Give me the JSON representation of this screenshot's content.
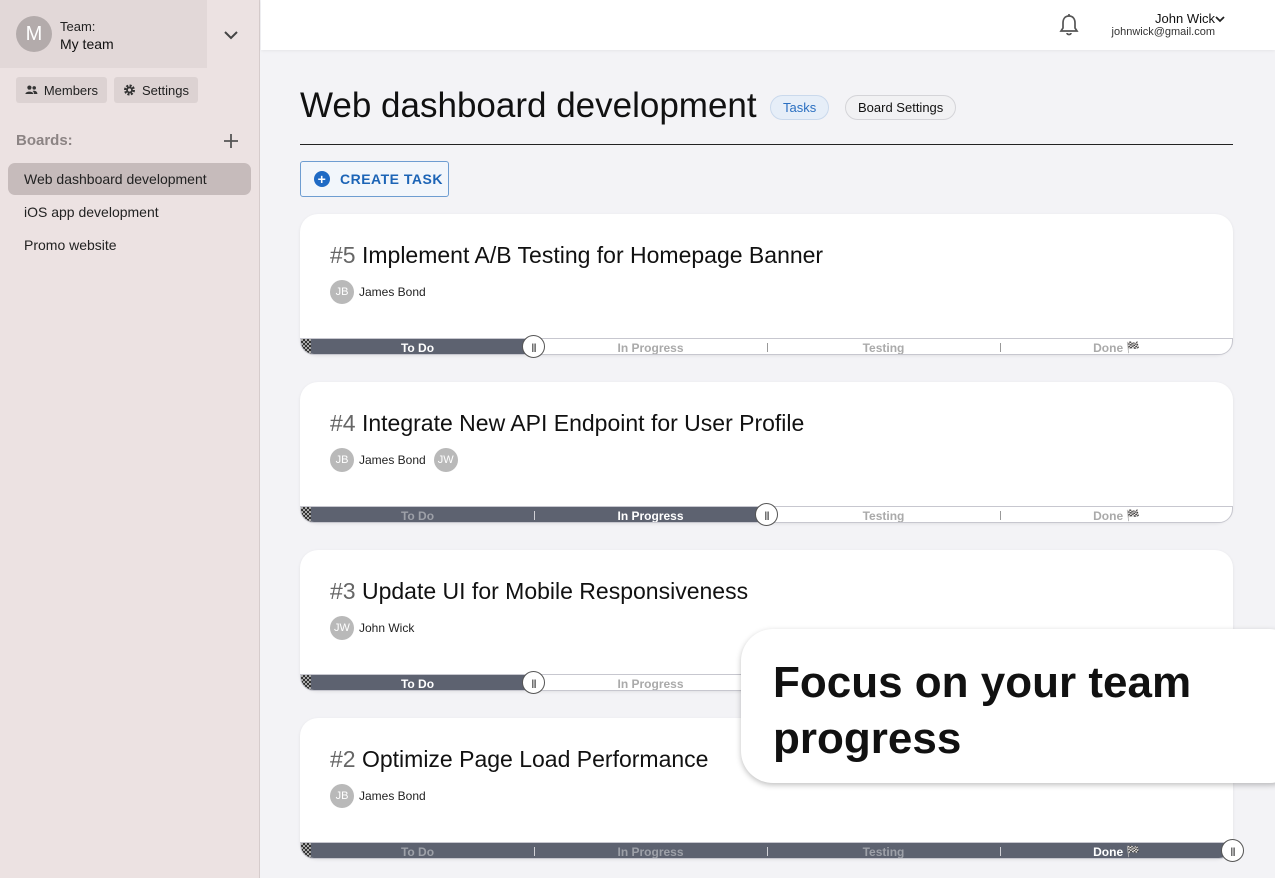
{
  "team": {
    "avatar_letter": "M",
    "label": "Team:",
    "name": "My team"
  },
  "sidebar": {
    "members_label": "Members",
    "settings_label": "Settings",
    "boards_label": "Boards:",
    "boards": [
      {
        "label": "Web dashboard development",
        "active": true
      },
      {
        "label": "iOS app development",
        "active": false
      },
      {
        "label": "Promo website",
        "active": false
      }
    ]
  },
  "user": {
    "name": "John Wick",
    "email": "johnwick@gmail.com"
  },
  "header": {
    "title": "Web dashboard development",
    "tabs": [
      {
        "label": "Tasks",
        "active": true
      },
      {
        "label": "Board Settings",
        "active": false
      }
    ],
    "create_label": "CREATE TASK"
  },
  "stages": [
    "To Do",
    "In Progress",
    "Testing",
    "Done"
  ],
  "tasks": [
    {
      "number": "#5",
      "title": "Implement A/B Testing for Homepage Banner",
      "assignees": [
        {
          "initials": "JB",
          "name": "James Bond"
        }
      ],
      "stage_index": 0
    },
    {
      "number": "#4",
      "title": "Integrate New API Endpoint for User Profile",
      "assignees": [
        {
          "initials": "JB",
          "name": "James Bond"
        },
        {
          "initials": "JW",
          "name": ""
        }
      ],
      "stage_index": 1
    },
    {
      "number": "#3",
      "title": "Update UI for Mobile Responsiveness",
      "assignees": [
        {
          "initials": "JW",
          "name": "John Wick"
        }
      ],
      "stage_index": 0
    },
    {
      "number": "#2",
      "title": "Optimize Page Load Performance",
      "assignees": [
        {
          "initials": "JB",
          "name": "James Bond"
        }
      ],
      "stage_index": 3
    }
  ],
  "promo": {
    "text": "Focus on your team progress"
  },
  "icons": {
    "team_toggle": "chevron-down-icon",
    "members": "people-icon",
    "settings": "gear-icon",
    "add_board": "plus-icon",
    "notifications": "bell-icon",
    "user_menu": "chevron-down-icon",
    "create": "plus-circle-icon",
    "stage_start": "checkered-flag-icon",
    "stage_done": "checkered-flag-icon",
    "progress_handle": "drag-handle-icon"
  },
  "colors": {
    "accent": "#1f6ac4",
    "track_fill": "#5d6270",
    "active_board": "#c6bbbb",
    "sidebar_bg": "#ece2e2"
  }
}
